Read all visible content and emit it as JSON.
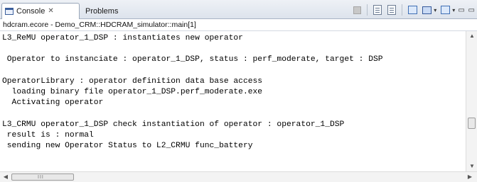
{
  "tabs": [
    {
      "label": "Console",
      "active": true
    },
    {
      "label": "Problems",
      "active": false
    }
  ],
  "description": "hdcram.ecore - Demo_CRM::HDCRAM_simulator::main[1]",
  "console_lines": [
    "L3_ReMU operator_1_DSP : instantiates new operator",
    "",
    " Operator to instanciate : operator_1_DSP, status : perf_moderate, target : DSP",
    "",
    "OperatorLibrary : operator definition data base access",
    "  loading binary file operator_1_DSP.perf_moderate.exe",
    "  Activating operator",
    "",
    "L3_CRMU operator_1_DSP check instantiation of operator : operator_1_DSP",
    " result is : normal",
    " sending new Operator Status to L2_CRMU func_battery"
  ],
  "icons": {
    "console_tab": "console-icon",
    "close": "close-icon",
    "terminate": "stop-icon",
    "clear": "doc-icon",
    "pin": "pin-icon",
    "display_selected": "monitor-icon",
    "open_console": "open-console-icon",
    "minimize": "minimize-icon"
  },
  "glyphs": {
    "close": "✕",
    "dropdown": "▾",
    "minimize": "▭ ▭",
    "arrow_up": "▲",
    "arrow_down": "▼",
    "arrow_left": "◀",
    "arrow_right": "▶",
    "grip": "III"
  }
}
